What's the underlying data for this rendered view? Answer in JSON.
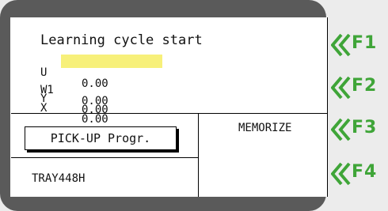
{
  "screen": {
    "title": "Learning cycle start",
    "axes": [
      {
        "label": "U",
        "value": "0.00"
      },
      {
        "label": "W1",
        "value": "0.00"
      },
      {
        "label": "Y",
        "value": "0.00"
      },
      {
        "label": "X",
        "value": "0.00"
      }
    ],
    "pickup_button": "PICK-UP Progr.",
    "memorize_label": "MEMORIZE",
    "tray_label": "TRAY448H"
  },
  "function_keys": [
    {
      "label": "F1",
      "icon": "chevron-left-icon"
    },
    {
      "label": "F2",
      "icon": "chevron-left-icon"
    },
    {
      "label": "F3",
      "icon": "chevron-left-icon"
    },
    {
      "label": "F4",
      "icon": "chevron-left-icon"
    }
  ],
  "colors": {
    "bezel": "#5a5a5a",
    "highlight": "#f7f07a",
    "fkey_green": "#3fa538"
  }
}
